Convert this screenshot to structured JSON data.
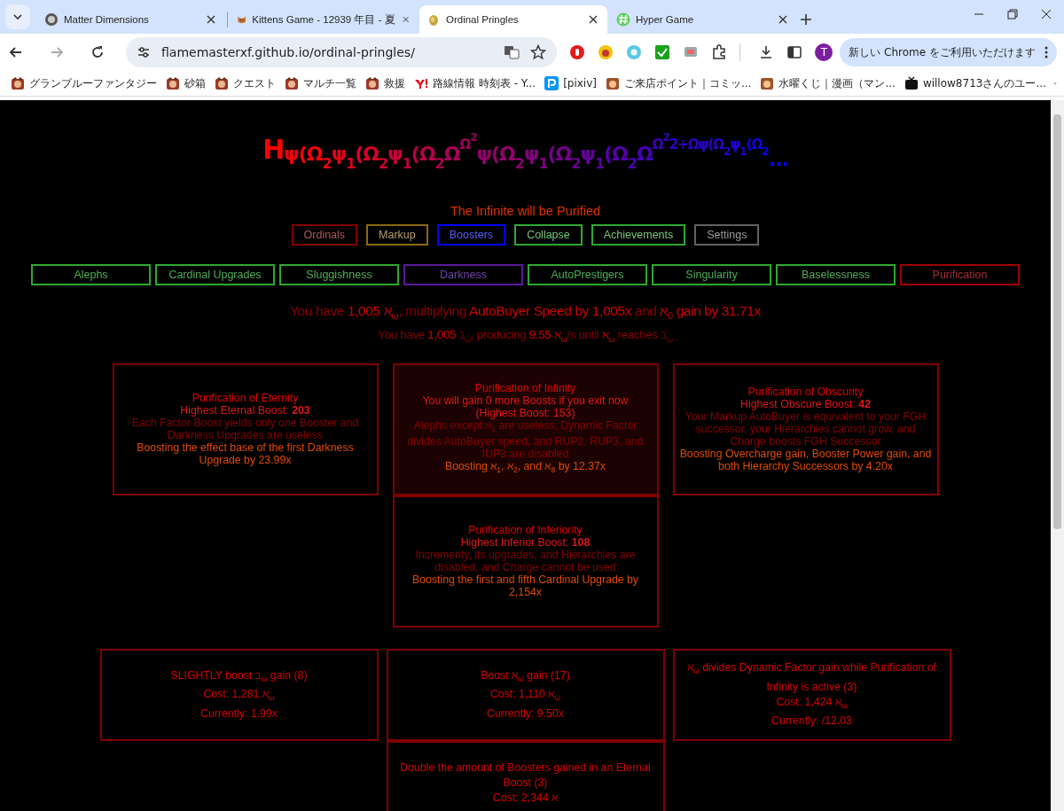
{
  "browser": {
    "tabs": [
      {
        "title": "Matter Dimensions",
        "kind": "globe",
        "selected": false
      },
      {
        "title": "Kittens Game - 12939 年目 - 夏",
        "kind": "cat",
        "selected": false
      },
      {
        "title": "Ordinal Pringles",
        "kind": "chip",
        "selected": true
      },
      {
        "title": "Hyper Game",
        "kind": "hash",
        "selected": false
      }
    ],
    "address": "flamemasterxf.github.io/ordinal-pringles/",
    "profile": "T",
    "update_button": "新しい Chrome をご利用いただけます",
    "bookmarks": [
      {
        "label": "グランブルーファンタジー",
        "kind": "game"
      },
      {
        "label": "砂箱",
        "kind": "game"
      },
      {
        "label": "クエスト",
        "kind": "game"
      },
      {
        "label": "マルチ一覧",
        "kind": "game"
      },
      {
        "label": "救援",
        "kind": "game"
      },
      {
        "label": "路線情報 時刻表 - Y...",
        "kind": "yahoo"
      },
      {
        "label": "[pixiv]",
        "kind": "pixiv"
      },
      {
        "label": "ご来店ポイント｜コミッ...",
        "kind": "shop"
      },
      {
        "label": "水曜くじ｜漫画（マン...",
        "kind": "shop"
      },
      {
        "label": "willow8713さんのユー...",
        "kind": "video"
      }
    ]
  },
  "game": {
    "ordinal": [
      {
        "text": "H",
        "kind": "head"
      },
      {
        "text": "ψ(Ω",
        "kind": "base"
      },
      {
        "text": "2",
        "kind": "sub"
      },
      {
        "text": "ψ",
        "kind": "base"
      },
      {
        "text": "1",
        "kind": "sub"
      },
      {
        "text": "(Ω",
        "kind": "base"
      },
      {
        "text": "2",
        "kind": "sub"
      },
      {
        "text": "ψ",
        "kind": "base"
      },
      {
        "text": "1",
        "kind": "sub"
      },
      {
        "text": "(Ω",
        "kind": "base"
      },
      {
        "text": "2",
        "kind": "sub"
      },
      {
        "text": "Ω",
        "kind": "base"
      },
      {
        "text": "Ω",
        "kind": "sup"
      },
      {
        "text": "2",
        "kind": "supsup"
      },
      {
        "text": "ψ(Ω",
        "kind": "base"
      },
      {
        "text": "2",
        "kind": "sub"
      },
      {
        "text": "ψ",
        "kind": "base"
      },
      {
        "text": "1",
        "kind": "sub"
      },
      {
        "text": "(Ω",
        "kind": "base"
      },
      {
        "text": "2",
        "kind": "sub"
      },
      {
        "text": "ψ",
        "kind": "base"
      },
      {
        "text": "1",
        "kind": "sub"
      },
      {
        "text": "(Ω",
        "kind": "base"
      },
      {
        "text": "2",
        "kind": "sub"
      },
      {
        "text": "Ω",
        "kind": "base"
      },
      {
        "text": "Ω",
        "kind": "sup"
      },
      {
        "text": "2",
        "kind": "supsup"
      },
      {
        "text": "2+Ωψ(Ω",
        "kind": "sup"
      },
      {
        "text": "2",
        "kind": "supsub"
      },
      {
        "text": "ψ",
        "kind": "sup"
      },
      {
        "text": "1",
        "kind": "supsub"
      },
      {
        "text": "(Ω",
        "kind": "sup"
      },
      {
        "text": "2",
        "kind": "supsub"
      },
      {
        "text": "...",
        "kind": "tail"
      }
    ],
    "subtitle": "The Infinite will be Purified",
    "main_tabs": [
      {
        "label": "Ordinals",
        "color": "#800000"
      },
      {
        "label": "Markup",
        "color": "#8b6914"
      },
      {
        "label": "Boosters",
        "color": "#0000ff"
      },
      {
        "label": "Collapse",
        "color": "#2fa82f"
      },
      {
        "label": "Achievements",
        "color": "#2fa82f"
      },
      {
        "label": "Settings",
        "color": "#606060"
      }
    ],
    "sub_tabs": [
      {
        "label": "Alephs",
        "color": "#2fa82f"
      },
      {
        "label": "Cardinal Upgrades",
        "color": "#2fa82f"
      },
      {
        "label": "Sluggishness",
        "color": "#2fa82f"
      },
      {
        "label": "Darkness",
        "color": "#5a1a9a"
      },
      {
        "label": "AutoPrestigers",
        "color": "#2fa82f"
      },
      {
        "label": "Singularity",
        "color": "#2fa82f"
      },
      {
        "label": "Baselessness",
        "color": "#2fa82f"
      },
      {
        "label": "Purification",
        "color": "#a00000"
      }
    ],
    "summary": [
      [
        {
          "text": "You have ",
          "kind": "dim"
        },
        {
          "text": "1,005 ℵ$_{ω}$",
          "kind": "bright"
        },
        {
          "text": ", multiplying ",
          "kind": "dim"
        },
        {
          "text": "AutoBuyer Speed by 1,005x",
          "kind": "bright"
        },
        {
          "text": " and ",
          "kind": "dim"
        },
        {
          "text": "ℵ$_{0}$ gain by 31.71x",
          "kind": "bright"
        }
      ],
      [
        {
          "text": "You have ",
          "kind": "dim"
        },
        {
          "text": "1,005",
          "kind": "bright"
        },
        {
          "text": " ℶ$_{ω}$, producing ",
          "kind": "dim"
        },
        {
          "text": "9.55 ℵ$_{ω}$",
          "kind": "bright"
        },
        {
          "text": "/s until ",
          "kind": "dim"
        },
        {
          "text": "ℵ$_{ω}$",
          "kind": "bright"
        },
        {
          "text": " reaches ℶ$_{ω}$",
          "kind": "dim"
        }
      ]
    ],
    "purifications": [
      {
        "active": false,
        "lines": [
          {
            "kind": "title",
            "text": "Purification of Eternity"
          },
          {
            "kind": "stat",
            "text": "Highest Eternal Boost: **203**"
          },
          {
            "kind": "description",
            "text": "Each Factor Boost yields only one Booster and Darkness Upgrades are useless"
          },
          {
            "kind": "effect",
            "text": "Boosting the effect base of the first Darkness Upgrade by 23.99x"
          }
        ]
      },
      {
        "active": true,
        "lines": [
          {
            "kind": "title",
            "text": "Purification of Infinity"
          },
          {
            "kind": "stat",
            "text": "You will gain 0 more Boosts if you exit now"
          },
          {
            "kind": "stat",
            "text": "(Highest Boost: 153)"
          },
          {
            "kind": "description",
            "text": "Alephs except ℵ$_{1}$ are useless, Dynamic Factor divides AutoBuyer speed, and RUP2, RUP3, and IUP3 are disabled"
          },
          {
            "kind": "effect",
            "text": "Boosting ℵ$_{1}$, ℵ$_{2}$, and ℵ$_{8}$ by 12.37x"
          }
        ]
      },
      {
        "active": false,
        "lines": [
          {
            "kind": "title",
            "text": "Purification of Obscurity"
          },
          {
            "kind": "stat",
            "text": "Highest Obscure Boost: **42**"
          },
          {
            "kind": "description",
            "text": "Your Markup AutoBuyer is equivalent to your FGH successor, your Hierarchies cannot grow, and Charge boosts FGH Successor"
          },
          {
            "kind": "effect",
            "text": "Boosting Overcharge gain, Booster Power gain, and both Hierarchy Successors by 4.20x"
          }
        ]
      },
      {
        "active": false,
        "lines": [
          {
            "kind": "title",
            "text": "Purification of Inferiority"
          },
          {
            "kind": "stat",
            "text": "Highest Inferior Boost: **108**"
          },
          {
            "kind": "description",
            "text": "Incrementy, its upgrades, and Hierarchies are disabled, and Charge cannot be used"
          },
          {
            "kind": "effect",
            "text": "Boosting the first and fifth Cardinal Upgrade by 2,154x"
          }
        ]
      }
    ],
    "upgrades": [
      {
        "lines": [
          "SLIGHTLY boost ℶ$_{ω}$ gain (8)",
          "Cost: 1,281 ℵ$_{ω}$",
          "Currently: 1.99x"
        ]
      },
      {
        "lines": [
          "Boost ℵ$_{ω}$ gain (17)",
          "Cost: 1,110 ℵ$_{ω}$",
          "Currently: 9.50x"
        ]
      },
      {
        "lines": [
          "ℵ$_{ω}$ divides Dynamic Factor gain while Purification of Infinity is active (3)",
          "Cost: 1,424 ℵ$_{ω}$",
          "Currently: /12.03"
        ]
      },
      {
        "lines": [
          "Double the amount of Boosters gained in an Eternal Boost (3)",
          "Cost: 2,344 ℵ"
        ]
      }
    ]
  }
}
